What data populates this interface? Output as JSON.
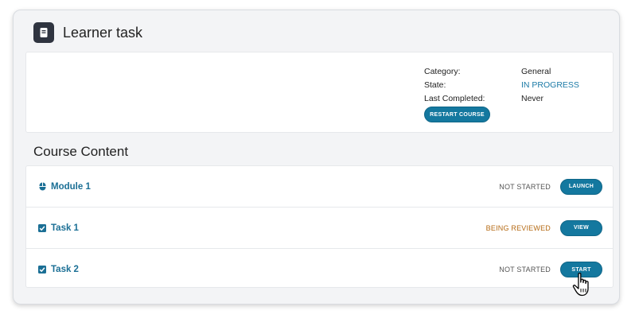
{
  "header": {
    "title": "Learner task",
    "icon": "book-icon"
  },
  "info": {
    "category_label": "Category:",
    "category_value": "General",
    "state_label": "State:",
    "state_value": "IN PROGRESS",
    "completed_label": "Last Completed:",
    "completed_value": "Never",
    "restart_label": "RESTART COURSE"
  },
  "content": {
    "title": "Course Content",
    "items": [
      {
        "title": "Module 1",
        "icon": "module-icon",
        "status": "NOT STARTED",
        "button": "LAUNCH"
      },
      {
        "title": "Task 1",
        "icon": "checkbox-icon",
        "status": "BEING REVIEWED",
        "button": "VIEW"
      },
      {
        "title": "Task 2",
        "icon": "checkbox-icon",
        "status": "NOT STARTED",
        "button": "START"
      }
    ]
  },
  "colors": {
    "accent": "#14789f",
    "link": "#1b6f95",
    "in_progress": "#1b7aa6",
    "review": "#b56a14"
  }
}
